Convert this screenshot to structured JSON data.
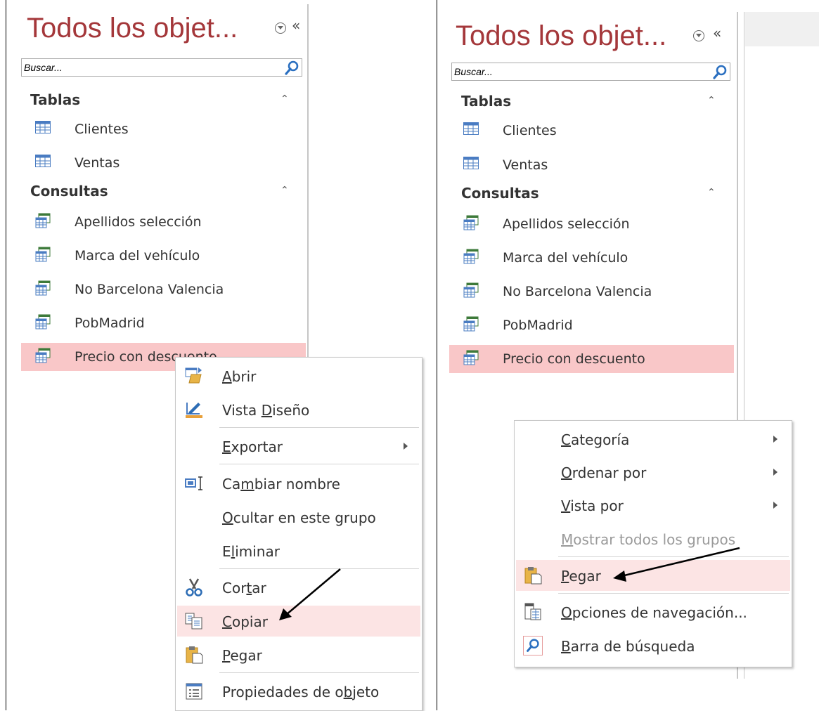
{
  "left": {
    "title": "Todos los objet...",
    "search_placeholder": "Buscar...",
    "groups": [
      {
        "label": "Tablas",
        "items": [
          "Clientes",
          "Ventas"
        ]
      },
      {
        "label": "Consultas",
        "items": [
          "Apellidos selección",
          "Marca del vehículo",
          "No Barcelona Valencia",
          "PobMadrid",
          "Precio con descuento"
        ]
      }
    ],
    "context_menu": [
      {
        "pre": "",
        "u": "A",
        "post": "brir"
      },
      {
        "pre": "Vista ",
        "u": "D",
        "post": "iseño"
      },
      {
        "pre": "",
        "u": "E",
        "post": "xportar"
      },
      {
        "pre": "Ca",
        "u": "m",
        "post": "biar nombre"
      },
      {
        "pre": "",
        "u": "O",
        "post": "cultar en este grupo"
      },
      {
        "pre": "E",
        "u": "l",
        "post": "iminar"
      },
      {
        "pre": "Cor",
        "u": "t",
        "post": "ar"
      },
      {
        "pre": "",
        "u": "C",
        "post": "opiar"
      },
      {
        "pre": "",
        "u": "P",
        "post": "egar"
      },
      {
        "pre": "Propiedades de o",
        "u": "b",
        "post": "jeto"
      }
    ]
  },
  "right": {
    "title": "Todos los objet...",
    "search_placeholder": "Buscar...",
    "groups": [
      {
        "label": "Tablas",
        "items": [
          "Clientes",
          "Ventas"
        ]
      },
      {
        "label": "Consultas",
        "items": [
          "Apellidos selección",
          "Marca del vehículo",
          "No Barcelona Valencia",
          "PobMadrid",
          "Precio con descuento"
        ]
      }
    ],
    "context_menu": [
      {
        "pre": "",
        "u": "C",
        "post": "ategoría"
      },
      {
        "pre": "",
        "u": "O",
        "post": "rdenar por"
      },
      {
        "pre": "",
        "u": "V",
        "post": "ista por"
      },
      {
        "pre": "",
        "u": "M",
        "post": "ostrar todos los grupos"
      },
      {
        "pre": "",
        "u": "P",
        "post": "egar"
      },
      {
        "pre": "",
        "u": "O",
        "post": "pciones de navegación..."
      },
      {
        "pre": "",
        "u": "B",
        "post": "arra de búsqueda"
      }
    ]
  },
  "colors": {
    "title": "#a4373a",
    "selected_item": "#f9c7c8",
    "hover_menu": "#fce4e4"
  },
  "icons": {
    "table": "table-icon",
    "query": "query-icon",
    "search": "search-icon",
    "dropdown": "chevron-down-circle-icon",
    "shutter": "double-chevron-left-icon",
    "collapse": "double-chevron-up-icon"
  }
}
